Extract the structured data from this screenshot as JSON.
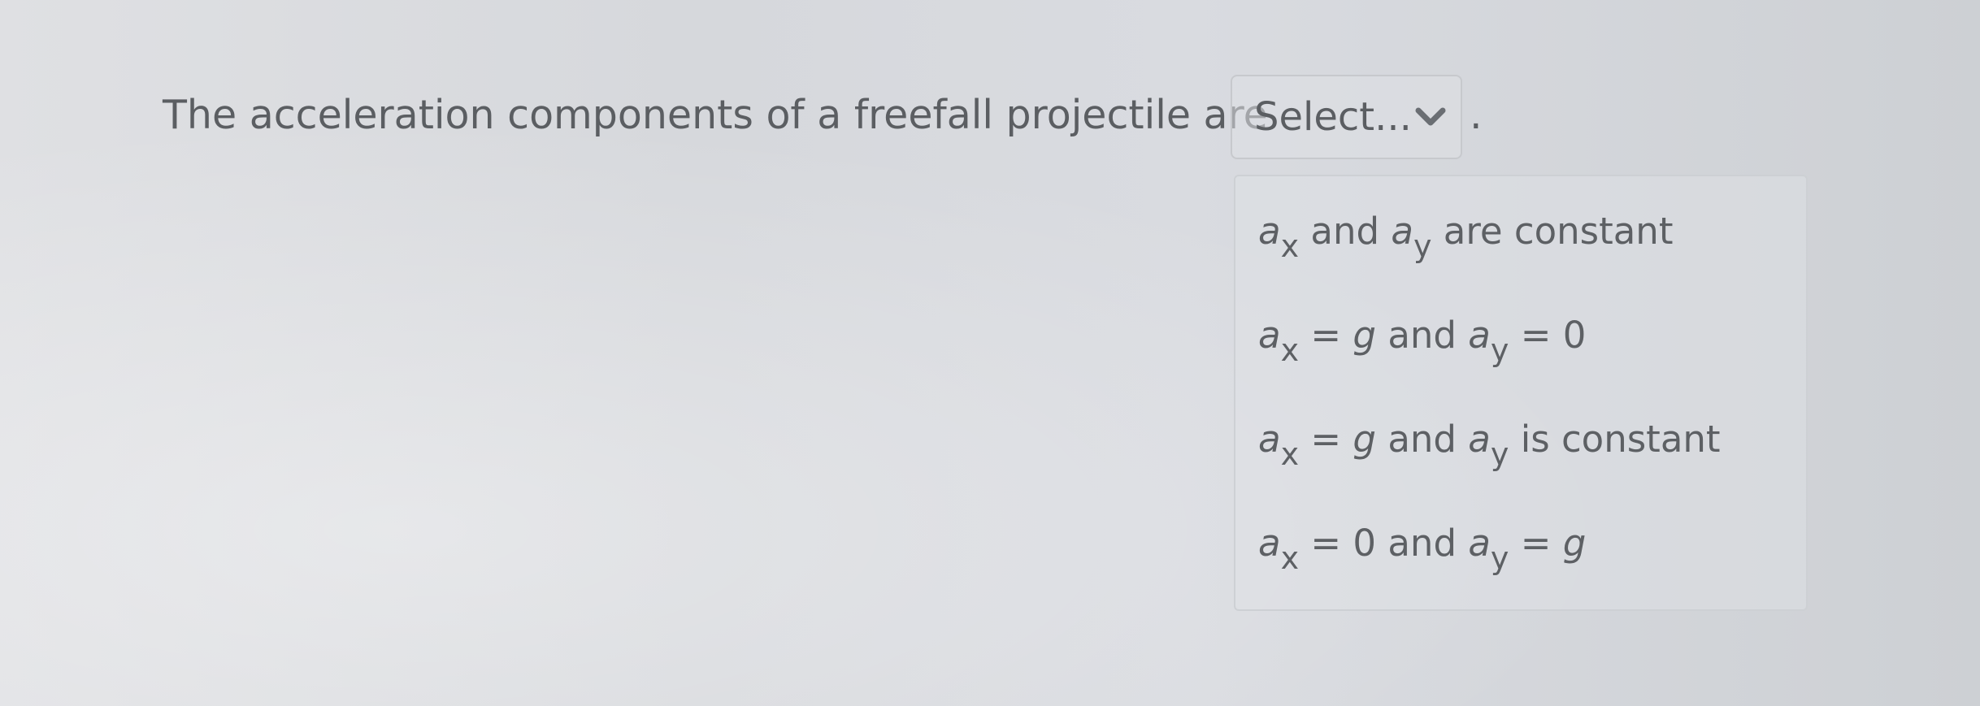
{
  "question": {
    "text": "The acceleration components of a freefall projectile are",
    "trailing_punctuation": "."
  },
  "select": {
    "label": "Select...",
    "icon": "chevron-down-icon"
  },
  "options": [
    {
      "a": "a",
      "x": "x",
      "mid": "and",
      "b": "a",
      "y": "y",
      "rest": "are constant"
    },
    {
      "a": "a",
      "x": "x",
      "eq1": "=",
      "g": "g",
      "mid": "and",
      "b": "a",
      "y": "y",
      "eq2": "= 0"
    },
    {
      "a": "a",
      "x": "x",
      "eq1": "=",
      "g": "g",
      "mid": "and",
      "b": "a",
      "y": "y",
      "rest": "is constant"
    },
    {
      "a": "a",
      "x": "x",
      "eq1": "= 0",
      "mid": "and",
      "b": "a",
      "y": "y",
      "eq2": "=",
      "g": "g"
    }
  ],
  "colors": {
    "text": "#5b5e62",
    "border": "#c7c9cd",
    "chevron": "#6a6e73"
  }
}
